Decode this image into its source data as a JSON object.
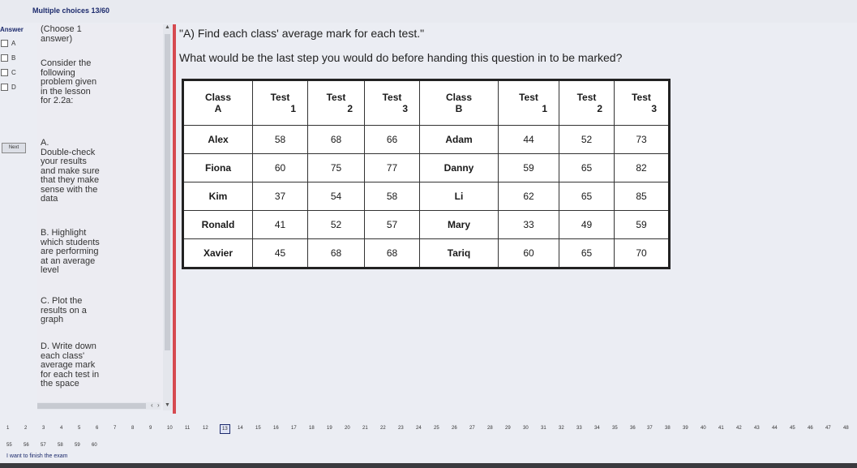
{
  "exam": {
    "title": "Multiple choices 13/60"
  },
  "answer": {
    "label": "Answer",
    "choices": [
      "A",
      "B",
      "C",
      "D"
    ],
    "next_label": "Next"
  },
  "left_panel": {
    "instruction": "(Choose 1\nanswer)",
    "context": "Consider the\nfollowing\nproblem given\nin the lesson\nfor 2.2a:",
    "option_a": "A.\nDouble-check\nyour results\nand make sure\nthat they make\nsense with the\ndata",
    "option_b": "B. Highlight\nwhich students\nare performing\nat an average\nlevel",
    "option_c": "C. Plot the\nresults on a\ngraph",
    "option_d": "D. Write down\neach class'\naverage mark\nfor each test in\nthe space"
  },
  "question": {
    "line1": "\"A) Find each class' average mark for each test.\"",
    "line2": "What would be the last step you would do before handing this question in to be marked?"
  },
  "table": {
    "headers": [
      [
        "Class",
        "A"
      ],
      [
        "Test",
        "1"
      ],
      [
        "Test",
        "2"
      ],
      [
        "Test",
        "3"
      ],
      [
        "Class",
        "B"
      ],
      [
        "Test",
        "1"
      ],
      [
        "Test",
        "2"
      ],
      [
        "Test",
        "3"
      ]
    ],
    "rows": [
      [
        "Alex",
        "58",
        "68",
        "66",
        "Adam",
        "44",
        "52",
        "73"
      ],
      [
        "Fiona",
        "60",
        "75",
        "77",
        "Danny",
        "59",
        "65",
        "82"
      ],
      [
        "Kim",
        "37",
        "54",
        "58",
        "Li",
        "62",
        "65",
        "85"
      ],
      [
        "Ronald",
        "41",
        "52",
        "57",
        "Mary",
        "33",
        "49",
        "59"
      ],
      [
        "Xavier",
        "45",
        "68",
        "68",
        "Tariq",
        "60",
        "65",
        "70"
      ]
    ]
  },
  "pagination": {
    "current": "13",
    "pages": [
      "1",
      "2",
      "3",
      "4",
      "5",
      "6",
      "7",
      "8",
      "9",
      "10",
      "11",
      "12",
      "13",
      "14",
      "15",
      "16",
      "17",
      "18",
      "19",
      "20",
      "21",
      "22",
      "23",
      "24",
      "25",
      "26",
      "27",
      "28",
      "29",
      "30",
      "31",
      "32",
      "33",
      "34",
      "35",
      "36",
      "37",
      "38",
      "39",
      "40",
      "41",
      "42",
      "43",
      "44",
      "45",
      "46",
      "47",
      "48"
    ],
    "pages_row2": [
      "55",
      "56",
      "57",
      "58",
      "59",
      "60"
    ],
    "finish_label": "I want to finish the exam"
  }
}
